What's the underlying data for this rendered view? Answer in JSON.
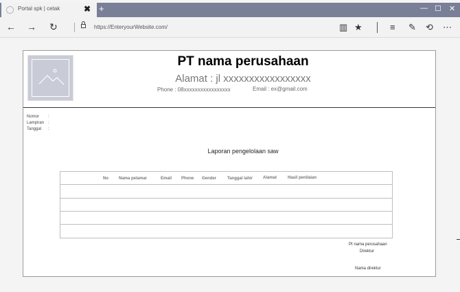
{
  "browser": {
    "tab_title": "Portal spk | cetak",
    "tab_close": "✖",
    "new_tab": "+",
    "minimize": "—",
    "maximize": "☐",
    "close": "✕",
    "back": "←",
    "forward": "→",
    "refresh": "↻",
    "url": "https://EnteryourWebsite.com/",
    "toolbar_icons": [
      "reading-view-icon",
      "favorite-star-icon",
      "hub-icon",
      "web-note-icon",
      "share-icon",
      "more-icon"
    ],
    "reading_view": "▥",
    "favorite": "★",
    "hub": "≡",
    "note": "✎",
    "share": "⟲",
    "more": "⋯"
  },
  "letterhead": {
    "company": "PT nama perusahaan",
    "address": "Alamat : jl xxxxxxxxxxxxxxxxx",
    "phone": "Phone : 08xxxxxxxxxxxxxxxxx",
    "email": "Email : ex@gmail.com"
  },
  "meta": {
    "nomor": "Nomor",
    "lampiran": "Lampiran",
    "tanggal": "Tanggal",
    "colon": ":"
  },
  "report": {
    "title": "Laporan pengelolaan saw",
    "columns": [
      "No",
      "Nama pelamar",
      "Email",
      "Phone",
      "Gender",
      "Tanggal lahir",
      "Alamat",
      "Hasil penilaian"
    ],
    "rows": 4
  },
  "signature": {
    "company": "Pt nama perusahaan",
    "role": "Direktur",
    "name": "Nama direktur"
  },
  "colors": {
    "tabbar": "#7a7f98",
    "logo_placeholder": "#c9ccd6"
  }
}
